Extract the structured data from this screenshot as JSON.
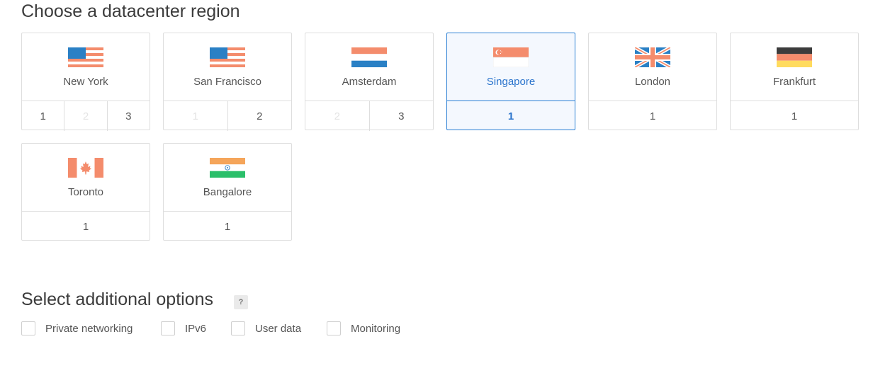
{
  "region_title": "Choose a datacenter region",
  "regions": [
    {
      "name": "New York",
      "flag": "us-flag-icon",
      "datacenters": [
        {
          "label": "1",
          "enabled": true
        },
        {
          "label": "2",
          "enabled": false
        },
        {
          "label": "3",
          "enabled": true
        }
      ]
    },
    {
      "name": "San Francisco",
      "flag": "us-flag-icon",
      "datacenters": [
        {
          "label": "1",
          "enabled": false
        },
        {
          "label": "2",
          "enabled": true
        }
      ]
    },
    {
      "name": "Amsterdam",
      "flag": "nl-flag-icon",
      "datacenters": [
        {
          "label": "2",
          "enabled": false
        },
        {
          "label": "3",
          "enabled": true
        }
      ]
    },
    {
      "name": "Singapore",
      "flag": "sg-flag-icon",
      "selected": true,
      "datacenters": [
        {
          "label": "1",
          "enabled": true
        }
      ]
    },
    {
      "name": "London",
      "flag": "uk-flag-icon",
      "datacenters": [
        {
          "label": "1",
          "enabled": true
        }
      ]
    },
    {
      "name": "Frankfurt",
      "flag": "de-flag-icon",
      "datacenters": [
        {
          "label": "1",
          "enabled": true
        }
      ]
    },
    {
      "name": "Toronto",
      "flag": "ca-flag-icon",
      "datacenters": [
        {
          "label": "1",
          "enabled": true
        }
      ]
    },
    {
      "name": "Bangalore",
      "flag": "in-flag-icon",
      "datacenters": [
        {
          "label": "1",
          "enabled": true
        }
      ]
    }
  ],
  "options_title": "Select additional options",
  "help_label": "?",
  "options": [
    {
      "label": "Private networking",
      "checked": false
    },
    {
      "label": "IPv6",
      "checked": false
    },
    {
      "label": "User data",
      "checked": false
    },
    {
      "label": "Monitoring",
      "checked": false
    }
  ],
  "colors": {
    "accent": "#2a7fd4",
    "selected_bg": "#f4f8fe",
    "border": "#dedede"
  }
}
